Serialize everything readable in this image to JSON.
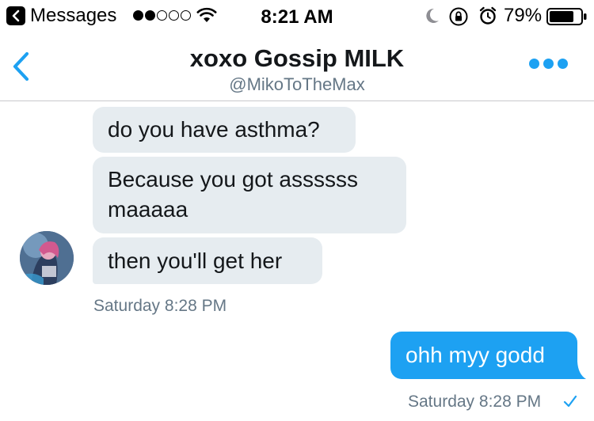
{
  "status_bar": {
    "back_app_label": "Messages",
    "time": "8:21 AM",
    "battery_percent": "79%",
    "signal_bars_filled": 2,
    "signal_bars_total": 5,
    "battery_level": 0.79,
    "icons": [
      "back-chevron-icon",
      "wifi-icon",
      "moon-icon",
      "rotation-lock-icon",
      "alarm-icon",
      "battery-icon"
    ]
  },
  "header": {
    "title": "xoxo Gossip MILK",
    "handle": "@MikoToTheMax",
    "accent_color": "#1da1f2"
  },
  "messages": [
    {
      "direction": "received",
      "text": "do you have asthma?"
    },
    {
      "direction": "received",
      "text": "Because you got assssss maaaaa"
    },
    {
      "direction": "received",
      "text": "then you'll get her"
    },
    {
      "direction": "sent",
      "text": "ohh myy godd"
    }
  ],
  "timestamps": {
    "received_group": "Saturday 8:28 PM",
    "sent_group": "Saturday 8:28 PM"
  },
  "colors": {
    "received_bubble": "#e6ecf0",
    "sent_bubble": "#1da1f2",
    "secondary_text": "#657786"
  }
}
